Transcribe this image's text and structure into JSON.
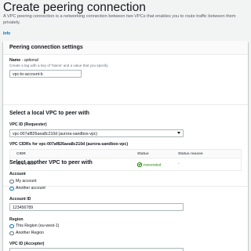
{
  "page": {
    "title": "Create peering connection",
    "description": "A VPC peering connection is a networking connection between two VPCs that enables you to route traffic between them privately.",
    "info_link": "Info"
  },
  "settings": {
    "heading": "Peering connection settings",
    "name_label": "Name",
    "name_optional": "- optional",
    "name_hint": "Create a tag with a key of 'Name' and a value that you specify.",
    "name_value": "vpc-to-account-b"
  },
  "local_vpc": {
    "heading": "Select a local VPC to peer with",
    "vpc_id_label": "VPC ID (Requester)",
    "vpc_id_value": "vpc-007af826aea8c210d (aurora-sandbox-vpc)",
    "cidrs_label": "VPC CIDRs for vpc-007af826aea8c210d (aurora-sandbox-vpc)",
    "table": {
      "columns": [
        "CIDR",
        "Status",
        "Status reason"
      ],
      "rows": [
        {
          "cidr": "50.0.0.0/24",
          "status": "Associated",
          "reason": "-"
        }
      ]
    }
  },
  "peer_vpc": {
    "heading": "Select another VPC to peer with",
    "account_label": "Account",
    "account_options": [
      {
        "label": "My account",
        "checked": false
      },
      {
        "label": "Another account",
        "checked": true
      }
    ],
    "account_id_label": "Account ID",
    "account_id_value": "123456789",
    "region_label": "Region",
    "region_options": [
      {
        "label": "This Region (eu-west-1)",
        "checked": true
      },
      {
        "label": "Another Region",
        "checked": false
      }
    ],
    "accepter_label": "VPC ID (Accepter)"
  },
  "colors": {
    "link": "#0073bb",
    "success": "#1d8102",
    "page_bg": "#f2f3f3"
  }
}
